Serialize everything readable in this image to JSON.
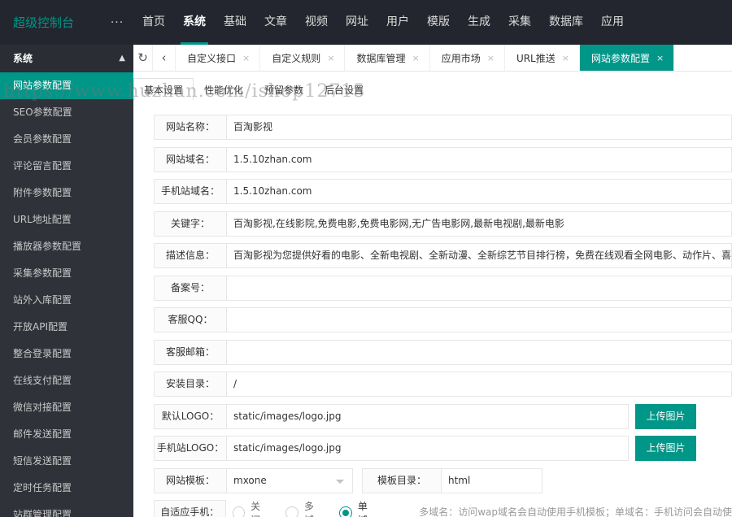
{
  "topbar": {
    "brand": "超级控制台",
    "more": "···",
    "nav": [
      "首页",
      "系统",
      "基础",
      "文章",
      "视频",
      "网址",
      "用户",
      "模版",
      "生成",
      "采集",
      "数据库",
      "应用"
    ],
    "active_index": 1
  },
  "sidebar": {
    "header": "系统",
    "items": [
      "网站参数配置",
      "SEO参数配置",
      "会员参数配置",
      "评论留言配置",
      "附件参数配置",
      "URL地址配置",
      "播放器参数配置",
      "采集参数配置",
      "站外入库配置",
      "开放API配置",
      "整合登录配置",
      "在线支付配置",
      "微信对接配置",
      "邮件发送配置",
      "短信发送配置",
      "定时任务配置",
      "站群管理配置"
    ],
    "active_index": 0
  },
  "tabs": {
    "items": [
      "自定义接口",
      "自定义规则",
      "数据库管理",
      "应用市场",
      "URL推送",
      "网站参数配置"
    ],
    "active_index": 5,
    "close": "×"
  },
  "subtabs": {
    "items": [
      "基本设置",
      "性能优化",
      "预留参数",
      "后台设置"
    ],
    "active_index": 0
  },
  "watermark": "https://www.huzhan.com/ishop12715",
  "form": {
    "site_name": {
      "label": "网站名称：",
      "value": "百淘影视"
    },
    "domain": {
      "label": "网站域名：",
      "value": "1.5.10zhan.com"
    },
    "mobile_domain": {
      "label": "手机站域名：",
      "value": "1.5.10zhan.com"
    },
    "keywords": {
      "label": "关键字：",
      "value": "百淘影视,在线影院,免费电影,免费电影网,无广告电影网,最新电视剧,最新电影"
    },
    "description": {
      "label": "描述信息：",
      "value": "百淘影视为您提供好看的电影、全新电视剧、全新动漫、全新综艺节目排行榜，免费在线观看全网电影、动作片、喜剧片"
    },
    "icp": {
      "label": "备案号：",
      "value": ""
    },
    "qq": {
      "label": "客服QQ：",
      "value": ""
    },
    "email": {
      "label": "客服邮箱：",
      "value": ""
    },
    "install_dir": {
      "label": "安装目录：",
      "value": "/"
    },
    "logo": {
      "label": "默认LOGO：",
      "value": "static/images/logo.jpg",
      "button": "上传图片"
    },
    "mobile_logo": {
      "label": "手机站LOGO：",
      "value": "static/images/logo.jpg",
      "button": "上传图片"
    },
    "template": {
      "label": "网站模板：",
      "value": "mxone"
    },
    "template_dir": {
      "label": "模板目录：",
      "value": "html"
    },
    "adaptive": {
      "label": "自适应手机：",
      "options": [
        "关闭",
        "多域",
        "单域"
      ],
      "checked_index": 2,
      "hint": "多域名：访问wap域名会自动使用手机模板；单域名：手机访问会自动使"
    }
  },
  "colors": {
    "accent": "#009688",
    "topbar": "#23262e",
    "sidebar": "#2f3239"
  }
}
